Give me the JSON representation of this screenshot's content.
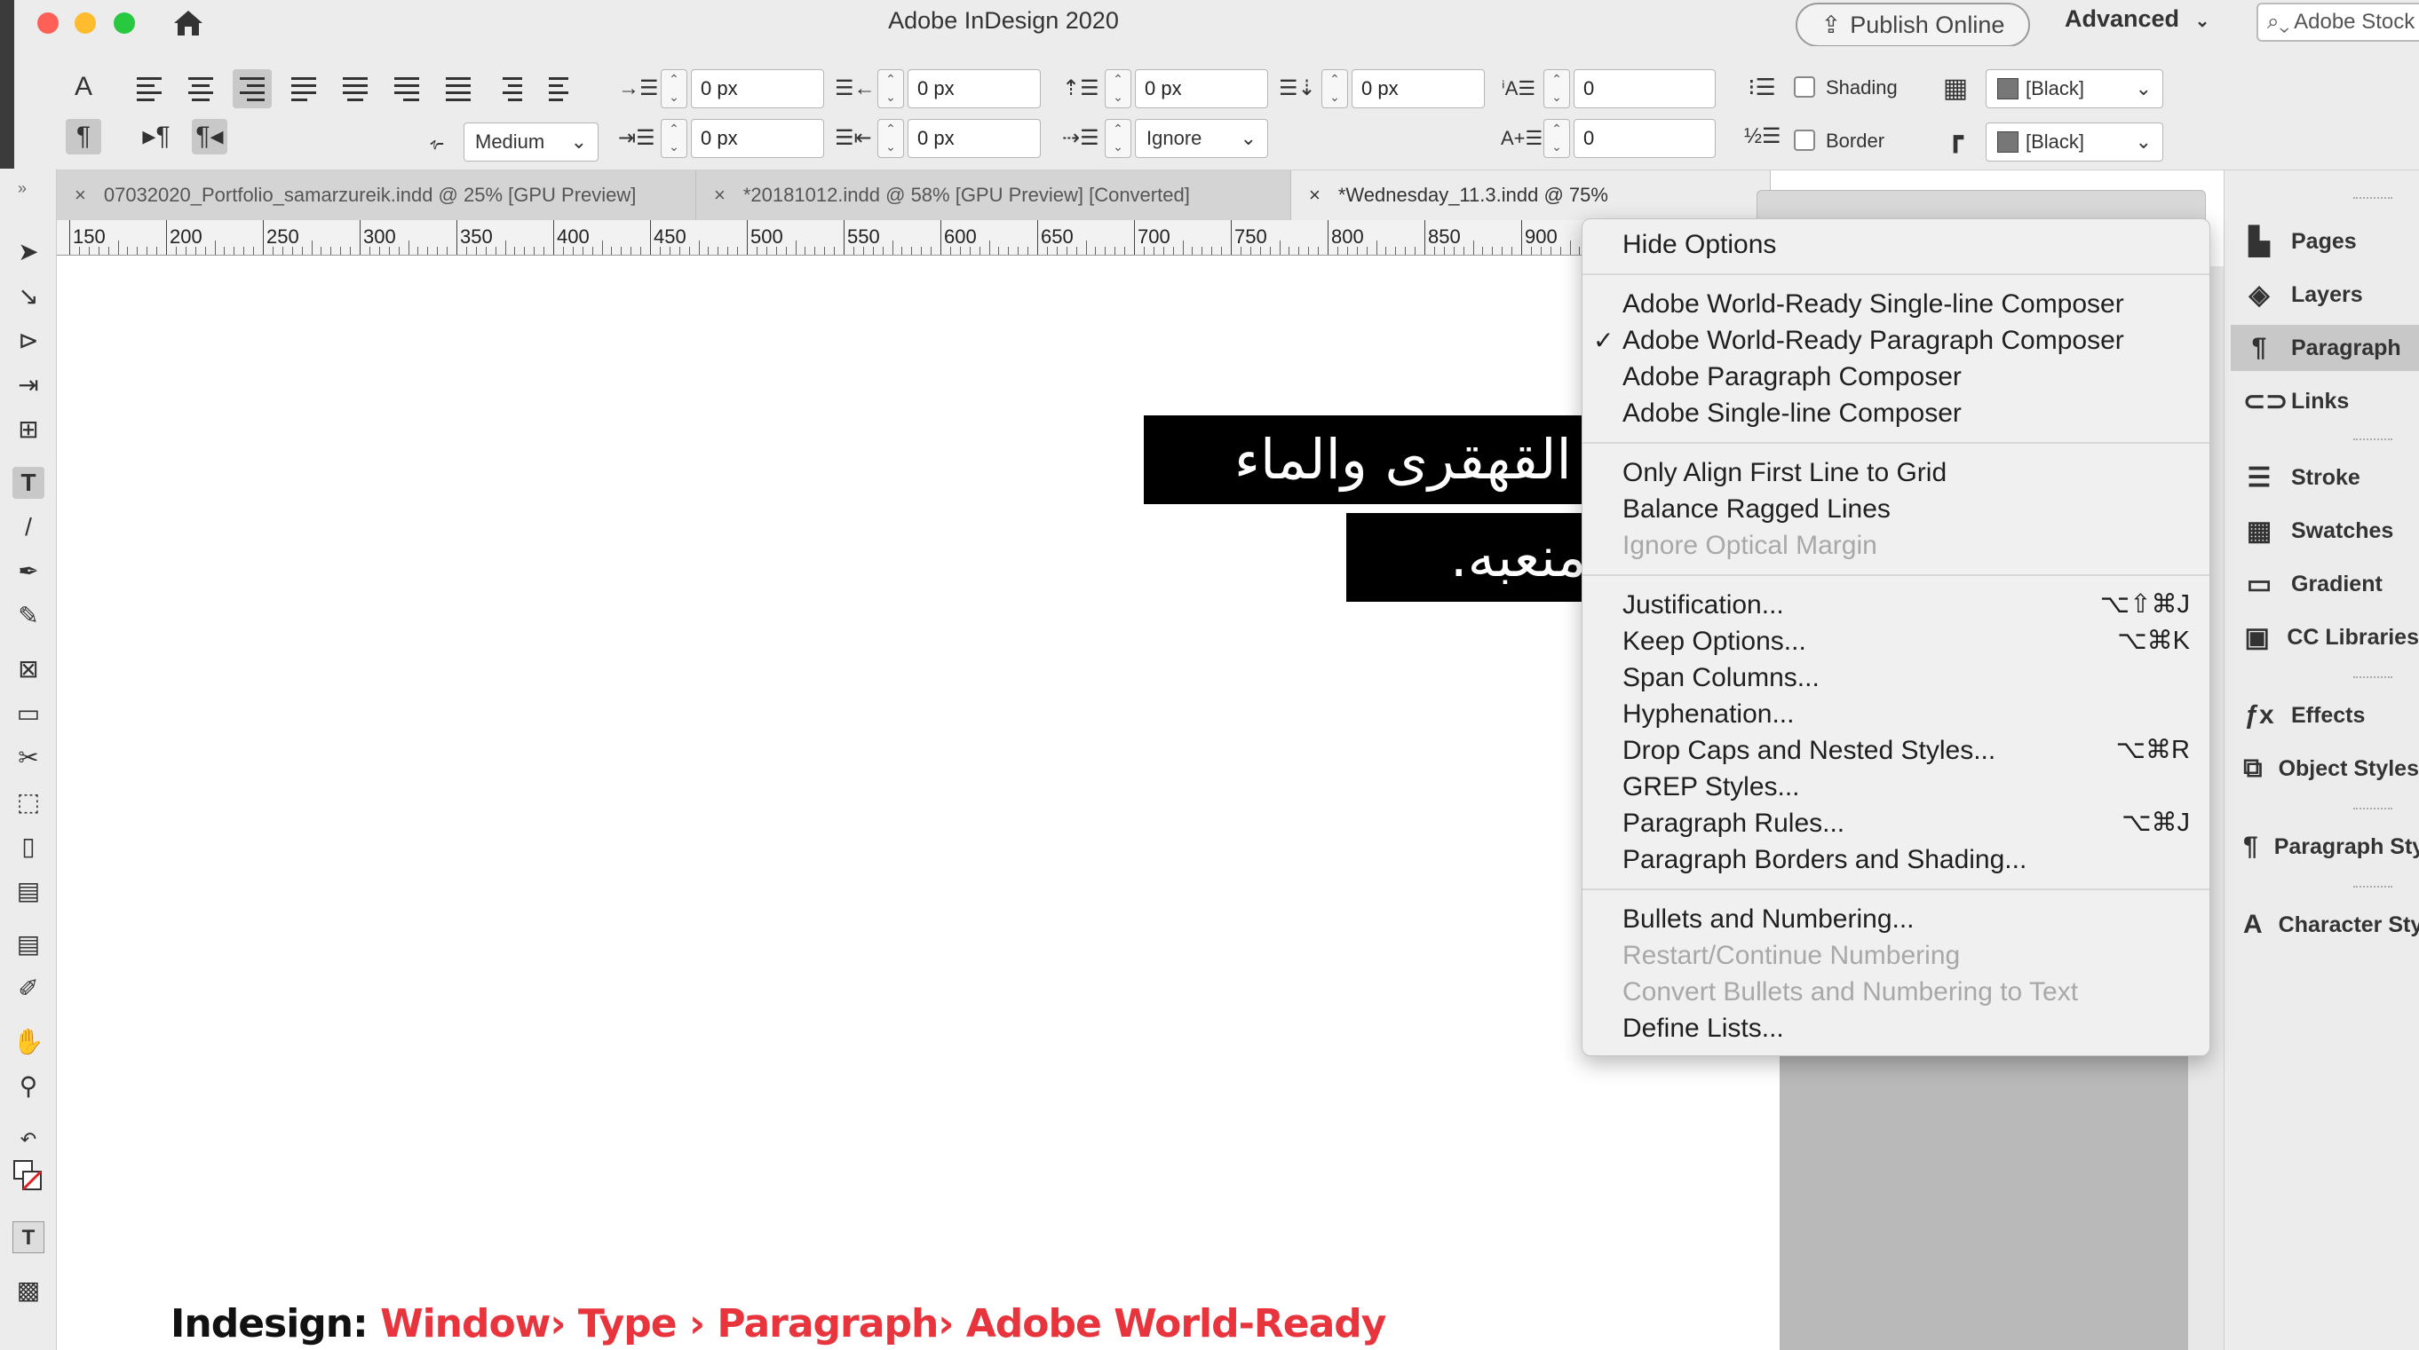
{
  "window": {
    "title": "Adobe InDesign 2020",
    "publish_label": "Publish Online",
    "workspace_label": "Advanced",
    "search_placeholder": "Adobe Stock"
  },
  "control_panel": {
    "indent_fields": [
      "0 px",
      "0 px",
      "0 px",
      "0 px",
      "0 px",
      "0 px"
    ],
    "kashida_value": "Medium",
    "ignore_value": "Ignore",
    "baseline_fields": [
      "0",
      "0"
    ],
    "shading_label": "Shading",
    "border_label": "Border",
    "shading_color": "[Black]",
    "border_color": "[Black]"
  },
  "tabs": [
    {
      "label": "07032020_Portfolio_samarzureik.indd @ 25% [GPU Preview]"
    },
    {
      "label": "*20181012.indd @ 58% [GPU Preview] [Converted]"
    },
    {
      "label": "*Wednesday_11.3.indd @ 75%"
    }
  ],
  "ruler": {
    "labels": [
      "150",
      "200",
      "250",
      "300",
      "350",
      "400",
      "450",
      "500",
      "550",
      "600",
      "650",
      "700",
      "750",
      "800",
      "850",
      "900"
    ]
  },
  "document": {
    "arabic_line1": "انه الريح لا ترجع القهقرى والماء",
    "arabic_line2": "لا يعود إلى يعود منعبه.",
    "caption_prefix": "Indesign:",
    "caption_path": "Window› Type › Paragraph› Adobe World-Ready"
  },
  "menu": {
    "hide_options": "Hide Options",
    "composers": [
      {
        "label": "Adobe World-Ready Single-line Composer",
        "checked": false
      },
      {
        "label": "Adobe World-Ready Paragraph Composer",
        "checked": true
      },
      {
        "label": "Adobe Paragraph Composer",
        "checked": false
      },
      {
        "label": "Adobe Single-line Composer",
        "checked": false
      }
    ],
    "grid_items": [
      {
        "label": "Only Align First Line to Grid",
        "disabled": false
      },
      {
        "label": "Balance Ragged Lines",
        "disabled": false
      },
      {
        "label": "Ignore Optical Margin",
        "disabled": true
      }
    ],
    "dialog_items": [
      {
        "label": "Justification...",
        "shortcut": "⌥⇧⌘J"
      },
      {
        "label": "Keep Options...",
        "shortcut": "⌥⌘K"
      },
      {
        "label": "Span Columns...",
        "shortcut": ""
      },
      {
        "label": "Hyphenation...",
        "shortcut": ""
      },
      {
        "label": "Drop Caps and Nested Styles...",
        "shortcut": "⌥⌘R"
      },
      {
        "label": "GREP Styles...",
        "shortcut": ""
      },
      {
        "label": "Paragraph Rules...",
        "shortcut": "⌥⌘J"
      },
      {
        "label": "Paragraph Borders and Shading...",
        "shortcut": ""
      }
    ],
    "list_items": [
      {
        "label": "Bullets and Numbering...",
        "disabled": false
      },
      {
        "label": "Restart/Continue Numbering",
        "disabled": true
      },
      {
        "label": "Convert Bullets and Numbering to Text",
        "disabled": true
      },
      {
        "label": "Define Lists...",
        "disabled": false
      }
    ]
  },
  "dock": {
    "items": [
      {
        "label": "Pages",
        "icon": "pages-icon",
        "glyph": "▙",
        "active": false
      },
      {
        "label": "Layers",
        "icon": "layers-icon",
        "glyph": "◈",
        "active": false
      },
      {
        "label": "Paragraph",
        "icon": "paragraph-icon",
        "glyph": "¶",
        "active": true
      },
      {
        "label": "Links",
        "icon": "links-icon",
        "glyph": "⊂⊃",
        "active": false
      },
      {
        "label": "Stroke",
        "icon": "stroke-icon",
        "glyph": "☰",
        "active": false
      },
      {
        "label": "Swatches",
        "icon": "swatches-icon",
        "glyph": "▦",
        "active": false
      },
      {
        "label": "Gradient",
        "icon": "gradient-icon",
        "glyph": "▭",
        "active": false
      },
      {
        "label": "CC Libraries",
        "icon": "cc-libraries-icon",
        "glyph": "▣",
        "active": false
      },
      {
        "label": "Effects",
        "icon": "effects-icon",
        "glyph": "ƒx",
        "active": false
      },
      {
        "label": "Object Styles",
        "icon": "object-styles-icon",
        "glyph": "⧉",
        "active": false
      },
      {
        "label": "Paragraph Styles",
        "icon": "paragraph-styles-icon",
        "glyph": "¶",
        "active": false
      },
      {
        "label": "Character Styles",
        "icon": "character-styles-icon",
        "glyph": "A",
        "active": false
      }
    ]
  },
  "colors": {
    "caption_accent": "#e8343c",
    "close_light": "#fe5f57",
    "minimize_light": "#febc2e",
    "zoom_light": "#28c840"
  }
}
